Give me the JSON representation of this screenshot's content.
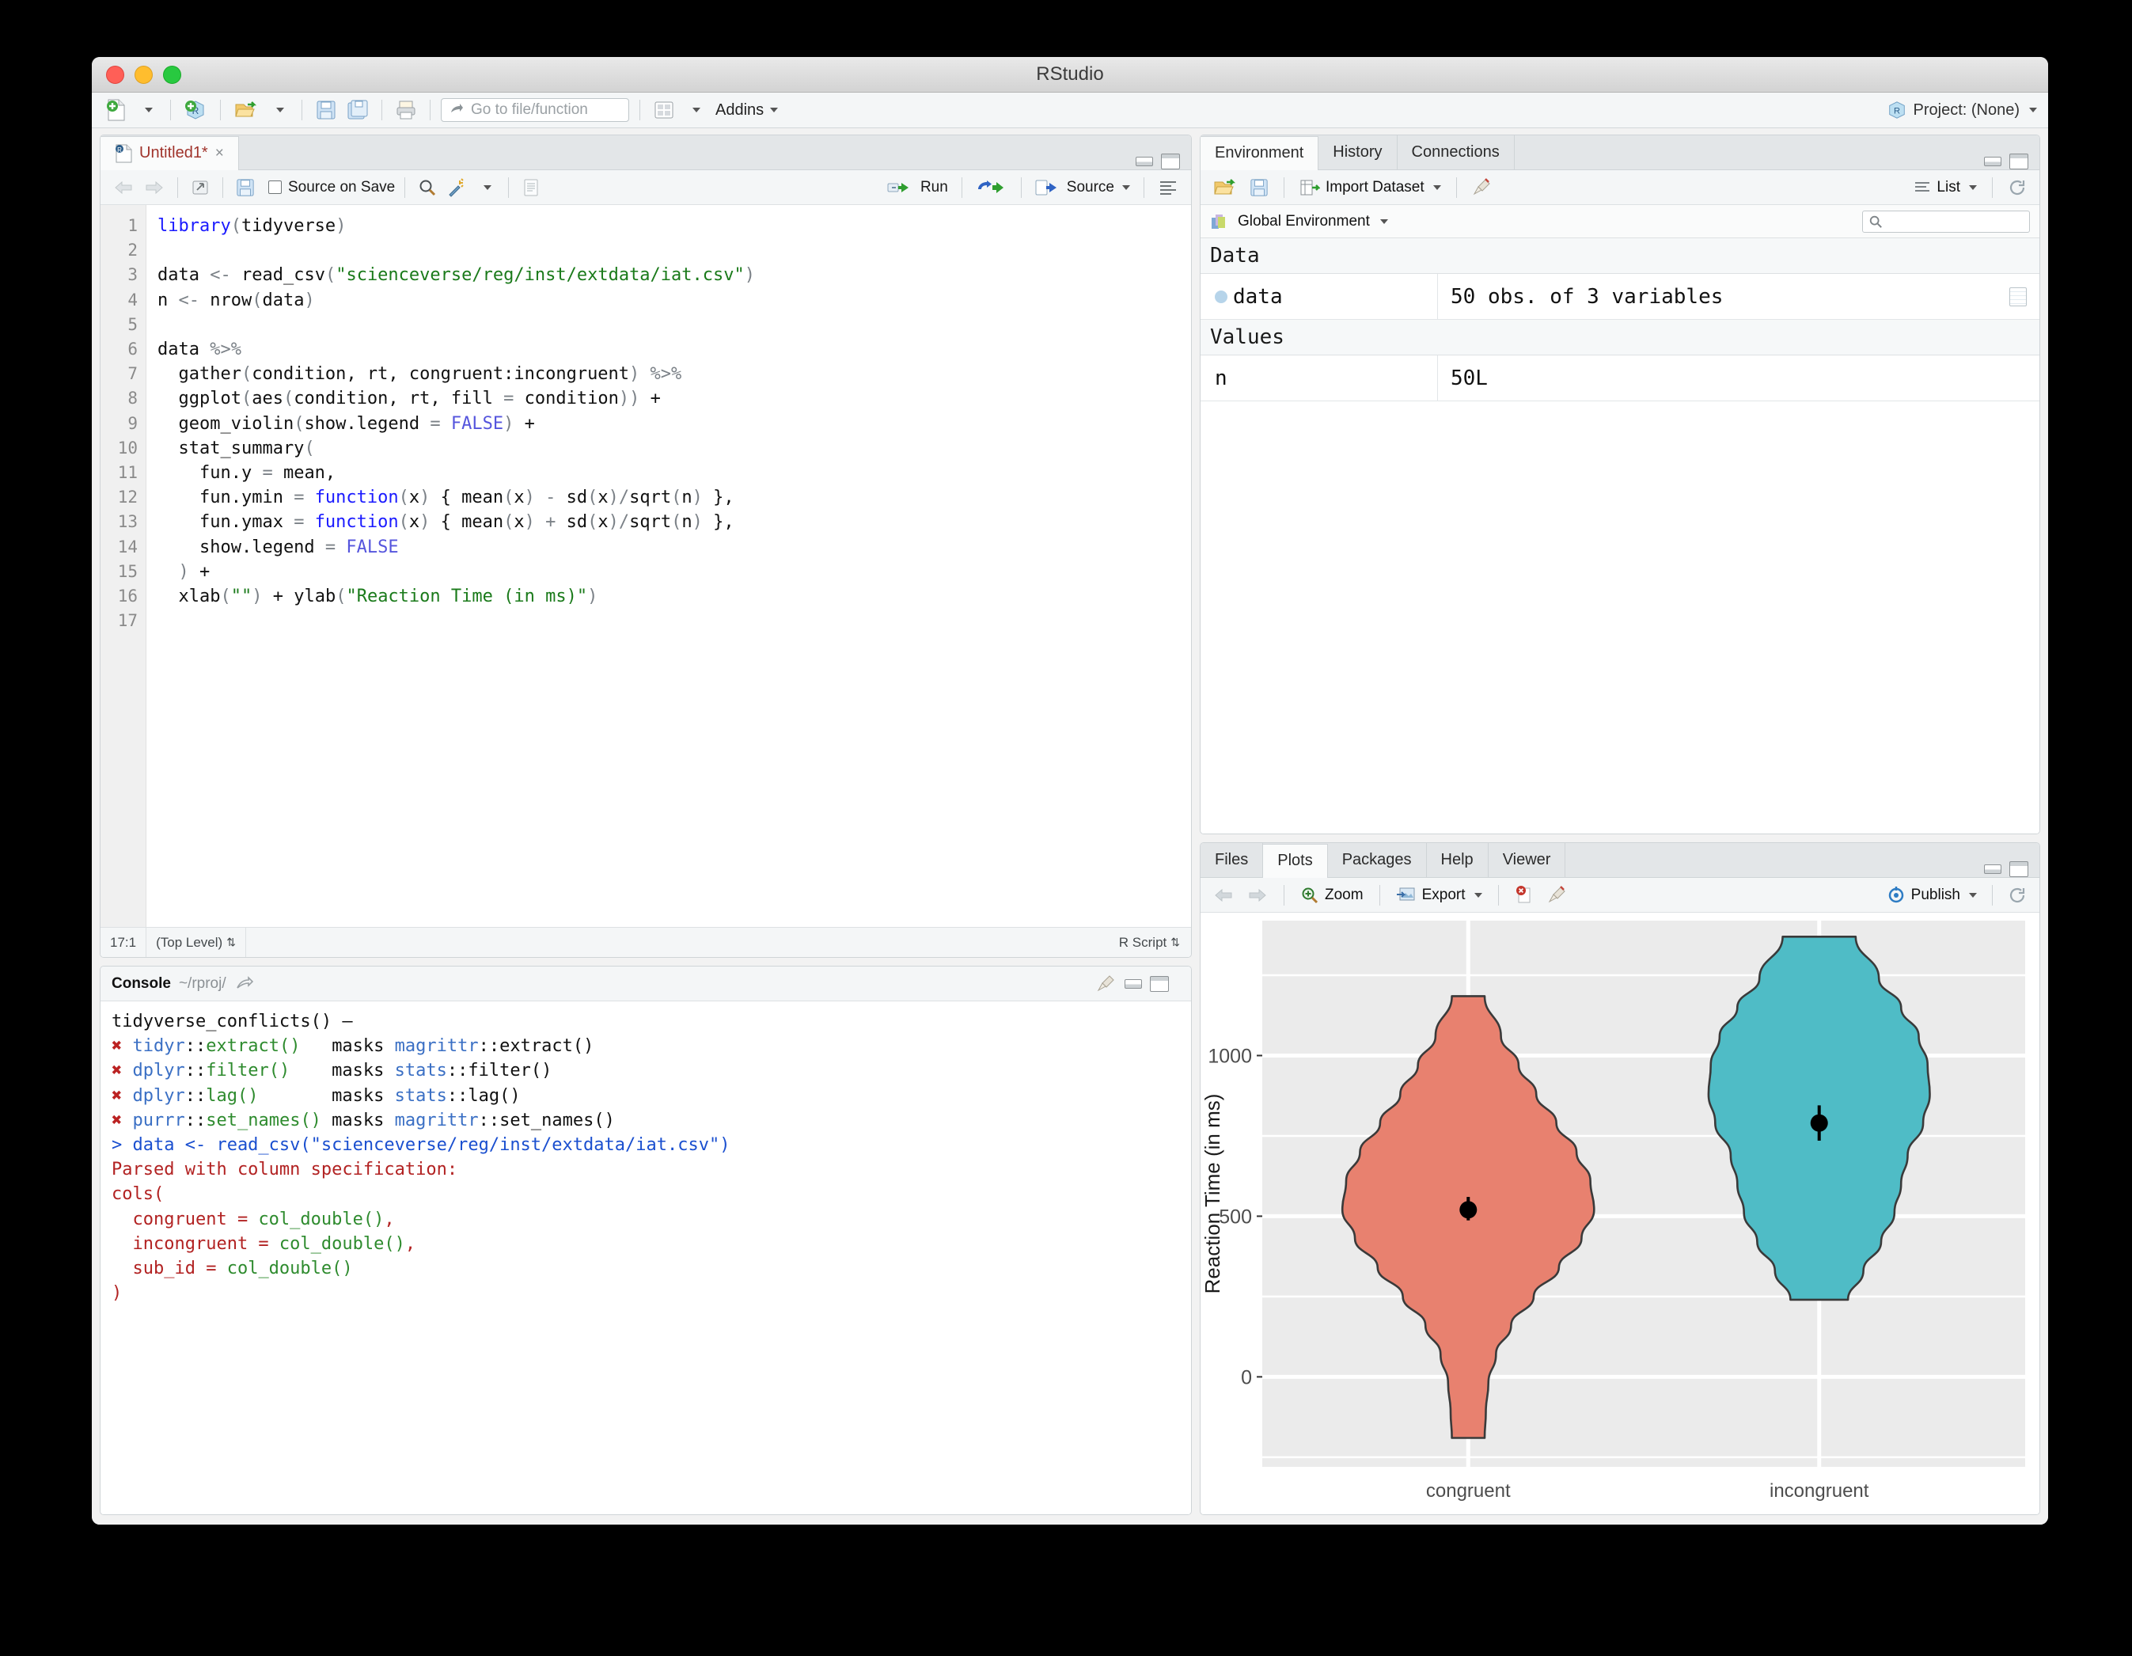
{
  "window": {
    "title": "RStudio"
  },
  "main_toolbar": {
    "new_file_icon": "new-file-icon",
    "new_project_icon": "new-project-icon",
    "open_icon": "open-folder-icon",
    "save_icon": "save-icon",
    "save_all_icon": "save-all-icon",
    "print_icon": "print-icon",
    "goto_placeholder": "Go to file/function",
    "workspace_panes_icon": "panes-layout-icon",
    "addins_label": "Addins",
    "project_label": "Project: (None)"
  },
  "source_pane": {
    "tab_label": "Untitled1*",
    "tab_close": "×",
    "toolbar": {
      "back_icon": "back-arrow-icon",
      "forward_icon": "forward-arrow-icon",
      "popout_icon": "show-in-new-window-icon",
      "save_icon": "save-icon",
      "source_on_save_label": "Source on Save",
      "find_icon": "magnifier-icon",
      "wand_icon": "code-tools-wand-icon",
      "compile_icon": "compile-report-icon",
      "run_label": "Run",
      "rerun_icon": "re-run-icon",
      "source_label": "Source",
      "outline_icon": "document-outline-icon"
    },
    "status": {
      "cursor": "17:1",
      "scope": "(Top Level)",
      "filetype": "R Script"
    },
    "code_lines": [
      {
        "n": "1",
        "tokens": [
          {
            "t": "library",
            "c": "fn"
          },
          {
            "t": "(",
            "c": "par"
          },
          {
            "t": "tidyverse",
            "c": ""
          },
          {
            "t": ")",
            "c": "par"
          }
        ]
      },
      {
        "n": "2",
        "tokens": []
      },
      {
        "n": "3",
        "tokens": [
          {
            "t": "data ",
            "c": ""
          },
          {
            "t": "<-",
            "c": "op"
          },
          {
            "t": " read_csv",
            "c": ""
          },
          {
            "t": "(",
            "c": "par"
          },
          {
            "t": "\"scienceverse/reg/inst/extdata/iat.csv\"",
            "c": "str"
          },
          {
            "t": ")",
            "c": "par"
          }
        ]
      },
      {
        "n": "4",
        "tokens": [
          {
            "t": "n ",
            "c": ""
          },
          {
            "t": "<-",
            "c": "op"
          },
          {
            "t": " nrow",
            "c": ""
          },
          {
            "t": "(",
            "c": "par"
          },
          {
            "t": "data",
            "c": ""
          },
          {
            "t": ")",
            "c": "par"
          }
        ]
      },
      {
        "n": "5",
        "tokens": []
      },
      {
        "n": "6",
        "tokens": [
          {
            "t": "data ",
            "c": ""
          },
          {
            "t": "%>%",
            "c": "op"
          }
        ]
      },
      {
        "n": "7",
        "tokens": [
          {
            "t": "  gather",
            "c": ""
          },
          {
            "t": "(",
            "c": "par"
          },
          {
            "t": "condition, rt, congruent:incongruent",
            "c": ""
          },
          {
            "t": ")",
            "c": "par"
          },
          {
            "t": " ",
            "c": ""
          },
          {
            "t": "%>%",
            "c": "op"
          }
        ]
      },
      {
        "n": "8",
        "tokens": [
          {
            "t": "  ggplot",
            "c": ""
          },
          {
            "t": "(",
            "c": "par"
          },
          {
            "t": "aes",
            "c": ""
          },
          {
            "t": "(",
            "c": "par"
          },
          {
            "t": "condition, rt, fill ",
            "c": ""
          },
          {
            "t": "=",
            "c": "op"
          },
          {
            "t": " condition",
            "c": ""
          },
          {
            "t": "))",
            "c": "par"
          },
          {
            "t": " +",
            "c": ""
          }
        ]
      },
      {
        "n": "9",
        "tokens": [
          {
            "t": "  geom_violin",
            "c": ""
          },
          {
            "t": "(",
            "c": "par"
          },
          {
            "t": "show.legend ",
            "c": ""
          },
          {
            "t": "=",
            "c": "op"
          },
          {
            "t": " ",
            "c": ""
          },
          {
            "t": "FALSE",
            "c": "const"
          },
          {
            "t": ")",
            "c": "par"
          },
          {
            "t": " +",
            "c": ""
          }
        ]
      },
      {
        "n": "10",
        "tokens": [
          {
            "t": "  stat_summary",
            "c": ""
          },
          {
            "t": "(",
            "c": "par"
          }
        ]
      },
      {
        "n": "11",
        "tokens": [
          {
            "t": "    fun.y ",
            "c": ""
          },
          {
            "t": "=",
            "c": "op"
          },
          {
            "t": " mean,",
            "c": ""
          }
        ]
      },
      {
        "n": "12",
        "tokens": [
          {
            "t": "    fun.ymin ",
            "c": ""
          },
          {
            "t": "=",
            "c": "op"
          },
          {
            "t": " ",
            "c": ""
          },
          {
            "t": "function",
            "c": "fn"
          },
          {
            "t": "(",
            "c": "par"
          },
          {
            "t": "x",
            "c": ""
          },
          {
            "t": ")",
            "c": "par"
          },
          {
            "t": " { mean",
            "c": ""
          },
          {
            "t": "(",
            "c": "par"
          },
          {
            "t": "x",
            "c": ""
          },
          {
            "t": ")",
            "c": "par"
          },
          {
            "t": " ",
            "c": ""
          },
          {
            "t": "-",
            "c": "op"
          },
          {
            "t": " sd",
            "c": ""
          },
          {
            "t": "(",
            "c": "par"
          },
          {
            "t": "x",
            "c": ""
          },
          {
            "t": ")",
            "c": "par"
          },
          {
            "t": "/",
            "c": "op"
          },
          {
            "t": "sqrt",
            "c": ""
          },
          {
            "t": "(",
            "c": "par"
          },
          {
            "t": "n",
            "c": ""
          },
          {
            "t": ")",
            "c": "par"
          },
          {
            "t": " },",
            "c": ""
          }
        ]
      },
      {
        "n": "13",
        "tokens": [
          {
            "t": "    fun.ymax ",
            "c": ""
          },
          {
            "t": "=",
            "c": "op"
          },
          {
            "t": " ",
            "c": ""
          },
          {
            "t": "function",
            "c": "fn"
          },
          {
            "t": "(",
            "c": "par"
          },
          {
            "t": "x",
            "c": ""
          },
          {
            "t": ")",
            "c": "par"
          },
          {
            "t": " { mean",
            "c": ""
          },
          {
            "t": "(",
            "c": "par"
          },
          {
            "t": "x",
            "c": ""
          },
          {
            "t": ")",
            "c": "par"
          },
          {
            "t": " ",
            "c": ""
          },
          {
            "t": "+",
            "c": "op"
          },
          {
            "t": " sd",
            "c": ""
          },
          {
            "t": "(",
            "c": "par"
          },
          {
            "t": "x",
            "c": ""
          },
          {
            "t": ")",
            "c": "par"
          },
          {
            "t": "/",
            "c": "op"
          },
          {
            "t": "sqrt",
            "c": ""
          },
          {
            "t": "(",
            "c": "par"
          },
          {
            "t": "n",
            "c": ""
          },
          {
            "t": ")",
            "c": "par"
          },
          {
            "t": " },",
            "c": ""
          }
        ]
      },
      {
        "n": "14",
        "tokens": [
          {
            "t": "    show.legend ",
            "c": ""
          },
          {
            "t": "=",
            "c": "op"
          },
          {
            "t": " ",
            "c": ""
          },
          {
            "t": "FALSE",
            "c": "const"
          }
        ]
      },
      {
        "n": "15",
        "tokens": [
          {
            "t": "  )",
            "c": "par"
          },
          {
            "t": " +",
            "c": ""
          }
        ]
      },
      {
        "n": "16",
        "tokens": [
          {
            "t": "  xlab",
            "c": ""
          },
          {
            "t": "(",
            "c": "par"
          },
          {
            "t": "\"\"",
            "c": "str"
          },
          {
            "t": ")",
            "c": "par"
          },
          {
            "t": " + ylab",
            "c": ""
          },
          {
            "t": "(",
            "c": "par"
          },
          {
            "t": "\"Reaction Time (in ms)\"",
            "c": "str"
          },
          {
            "t": ")",
            "c": "par"
          }
        ]
      },
      {
        "n": "17",
        "tokens": []
      }
    ]
  },
  "console_pane": {
    "title": "Console",
    "path": "~/rproj/",
    "popout_icon": "console-popout-icon",
    "broom_icon": "clear-console-icon",
    "lines": [
      {
        "segs": [
          {
            "t": "tidyverse_conflicts() —",
            "c": "dark"
          }
        ]
      },
      {
        "segs": [
          {
            "t": "✖ ",
            "c": "x"
          },
          {
            "t": "tidyr",
            "c": "blue2"
          },
          {
            "t": "::",
            "c": "dark"
          },
          {
            "t": "extract()",
            "c": "green"
          },
          {
            "t": "   masks ",
            "c": "dark"
          },
          {
            "t": "magrittr",
            "c": "blue2"
          },
          {
            "t": "::extract()",
            "c": "dark"
          }
        ]
      },
      {
        "segs": [
          {
            "t": "✖ ",
            "c": "x"
          },
          {
            "t": "dplyr",
            "c": "blue2"
          },
          {
            "t": "::",
            "c": "dark"
          },
          {
            "t": "filter()",
            "c": "green"
          },
          {
            "t": "    masks ",
            "c": "dark"
          },
          {
            "t": "stats",
            "c": "blue2"
          },
          {
            "t": "::filter()",
            "c": "dark"
          }
        ]
      },
      {
        "segs": [
          {
            "t": "✖ ",
            "c": "x"
          },
          {
            "t": "dplyr",
            "c": "blue2"
          },
          {
            "t": "::",
            "c": "dark"
          },
          {
            "t": "lag()",
            "c": "green"
          },
          {
            "t": "       masks ",
            "c": "dark"
          },
          {
            "t": "stats",
            "c": "blue2"
          },
          {
            "t": "::lag()",
            "c": "dark"
          }
        ]
      },
      {
        "segs": [
          {
            "t": "✖ ",
            "c": "x"
          },
          {
            "t": "purrr",
            "c": "blue2"
          },
          {
            "t": "::",
            "c": "dark"
          },
          {
            "t": "set_names()",
            "c": "green"
          },
          {
            "t": " masks ",
            "c": "dark"
          },
          {
            "t": "magrittr",
            "c": "blue2"
          },
          {
            "t": "::set_names()",
            "c": "dark"
          }
        ]
      },
      {
        "segs": [
          {
            "t": "> data <- read_csv(\"scienceverse/reg/inst/extdata/iat.csv\")",
            "c": "blue"
          }
        ]
      },
      {
        "segs": [
          {
            "t": "Parsed with column specification:",
            "c": "red"
          }
        ]
      },
      {
        "segs": [
          {
            "t": "cols(",
            "c": "red"
          }
        ]
      },
      {
        "segs": [
          {
            "t": "  congruent = ",
            "c": "red"
          },
          {
            "t": "col_double()",
            "c": "green"
          },
          {
            "t": ",",
            "c": "red"
          }
        ]
      },
      {
        "segs": [
          {
            "t": "  incongruent = ",
            "c": "red"
          },
          {
            "t": "col_double()",
            "c": "green"
          },
          {
            "t": ",",
            "c": "red"
          }
        ]
      },
      {
        "segs": [
          {
            "t": "  sub_id = ",
            "c": "red"
          },
          {
            "t": "col_double()",
            "c": "green"
          }
        ]
      },
      {
        "segs": [
          {
            "t": ")",
            "c": "red"
          }
        ]
      }
    ]
  },
  "environment_pane": {
    "tabs": [
      {
        "label": "Environment",
        "active": true
      },
      {
        "label": "History",
        "active": false
      },
      {
        "label": "Connections",
        "active": false
      }
    ],
    "toolbar": {
      "open_icon": "open-workspace-icon",
      "save_icon": "save-workspace-icon",
      "import_label": "Import Dataset",
      "broom_icon": "clear-objects-icon",
      "view_mode_label": "List",
      "view_mode_icon": "list-view-icon",
      "refresh_icon": "refresh-icon"
    },
    "scope_label": "Global Environment",
    "scope_icon": "environment-cube-icon",
    "search_icon": "search-icon",
    "search_placeholder": "",
    "groups": [
      {
        "label": "Data",
        "rows": [
          {
            "name": "data",
            "value": "50 obs. of 3 variables",
            "expandable": true,
            "has_grid": true
          }
        ]
      },
      {
        "label": "Values",
        "rows": [
          {
            "name": "n",
            "value": "50L",
            "expandable": false,
            "has_grid": false
          }
        ]
      }
    ]
  },
  "plots_pane": {
    "tabs": [
      {
        "label": "Files",
        "active": false
      },
      {
        "label": "Plots",
        "active": true
      },
      {
        "label": "Packages",
        "active": false
      },
      {
        "label": "Help",
        "active": false
      },
      {
        "label": "Viewer",
        "active": false
      }
    ],
    "toolbar": {
      "prev_icon": "previous-plot-icon",
      "next_icon": "next-plot-icon",
      "zoom_label": "Zoom",
      "zoom_icon": "zoom-icon",
      "export_label": "Export",
      "export_icon": "export-icon",
      "remove_icon": "remove-plot-icon",
      "clear_icon": "clear-plots-icon",
      "publish_label": "Publish",
      "publish_icon": "publish-icon",
      "refresh_icon": "refresh-icon"
    }
  },
  "colors": {
    "congruent_fill": "#E8816F",
    "incongruent_fill": "#4FBCC6",
    "panel_bg": "#EBEBEB",
    "grid": "#FFFFFF",
    "outline": "#3A3A3A"
  },
  "chart_data": {
    "type": "violin",
    "title": "",
    "xlabel": "",
    "ylabel": "Reaction Time (in ms)",
    "categories": [
      "congruent",
      "incongruent"
    ],
    "ytick_labels": [
      "0",
      "500",
      "1000"
    ],
    "ytick_values": [
      0,
      500,
      1000
    ],
    "ylim": [
      -280,
      1420
    ],
    "grid": true,
    "legend": "none",
    "series": [
      {
        "name": "congruent",
        "fill": "#E8816F",
        "mean": 520,
        "se_low": 487,
        "se_high": 560,
        "range": [
          -190,
          1185
        ],
        "density_profile": [
          {
            "y": -190,
            "w": 0.13
          },
          {
            "y": -110,
            "w": 0.14
          },
          {
            "y": -20,
            "w": 0.16
          },
          {
            "y": 70,
            "w": 0.22
          },
          {
            "y": 160,
            "w": 0.34
          },
          {
            "y": 250,
            "w": 0.52
          },
          {
            "y": 340,
            "w": 0.72
          },
          {
            "y": 430,
            "w": 0.9
          },
          {
            "y": 520,
            "w": 1.0
          },
          {
            "y": 610,
            "w": 0.97
          },
          {
            "y": 700,
            "w": 0.86
          },
          {
            "y": 790,
            "w": 0.7
          },
          {
            "y": 880,
            "w": 0.54
          },
          {
            "y": 970,
            "w": 0.4
          },
          {
            "y": 1060,
            "w": 0.26
          },
          {
            "y": 1185,
            "w": 0.13
          }
        ]
      },
      {
        "name": "incongruent",
        "fill": "#4FBCC6",
        "mean": 790,
        "se_low": 735,
        "se_high": 845,
        "range": [
          240,
          1370
        ],
        "density_profile": [
          {
            "y": 240,
            "w": 0.26
          },
          {
            "y": 330,
            "w": 0.4
          },
          {
            "y": 420,
            "w": 0.56
          },
          {
            "y": 510,
            "w": 0.68
          },
          {
            "y": 600,
            "w": 0.74
          },
          {
            "y": 690,
            "w": 0.8
          },
          {
            "y": 790,
            "w": 0.94
          },
          {
            "y": 880,
            "w": 1.0
          },
          {
            "y": 970,
            "w": 0.98
          },
          {
            "y": 1060,
            "w": 0.9
          },
          {
            "y": 1150,
            "w": 0.74
          },
          {
            "y": 1240,
            "w": 0.54
          },
          {
            "y": 1370,
            "w": 0.33
          }
        ]
      }
    ]
  }
}
